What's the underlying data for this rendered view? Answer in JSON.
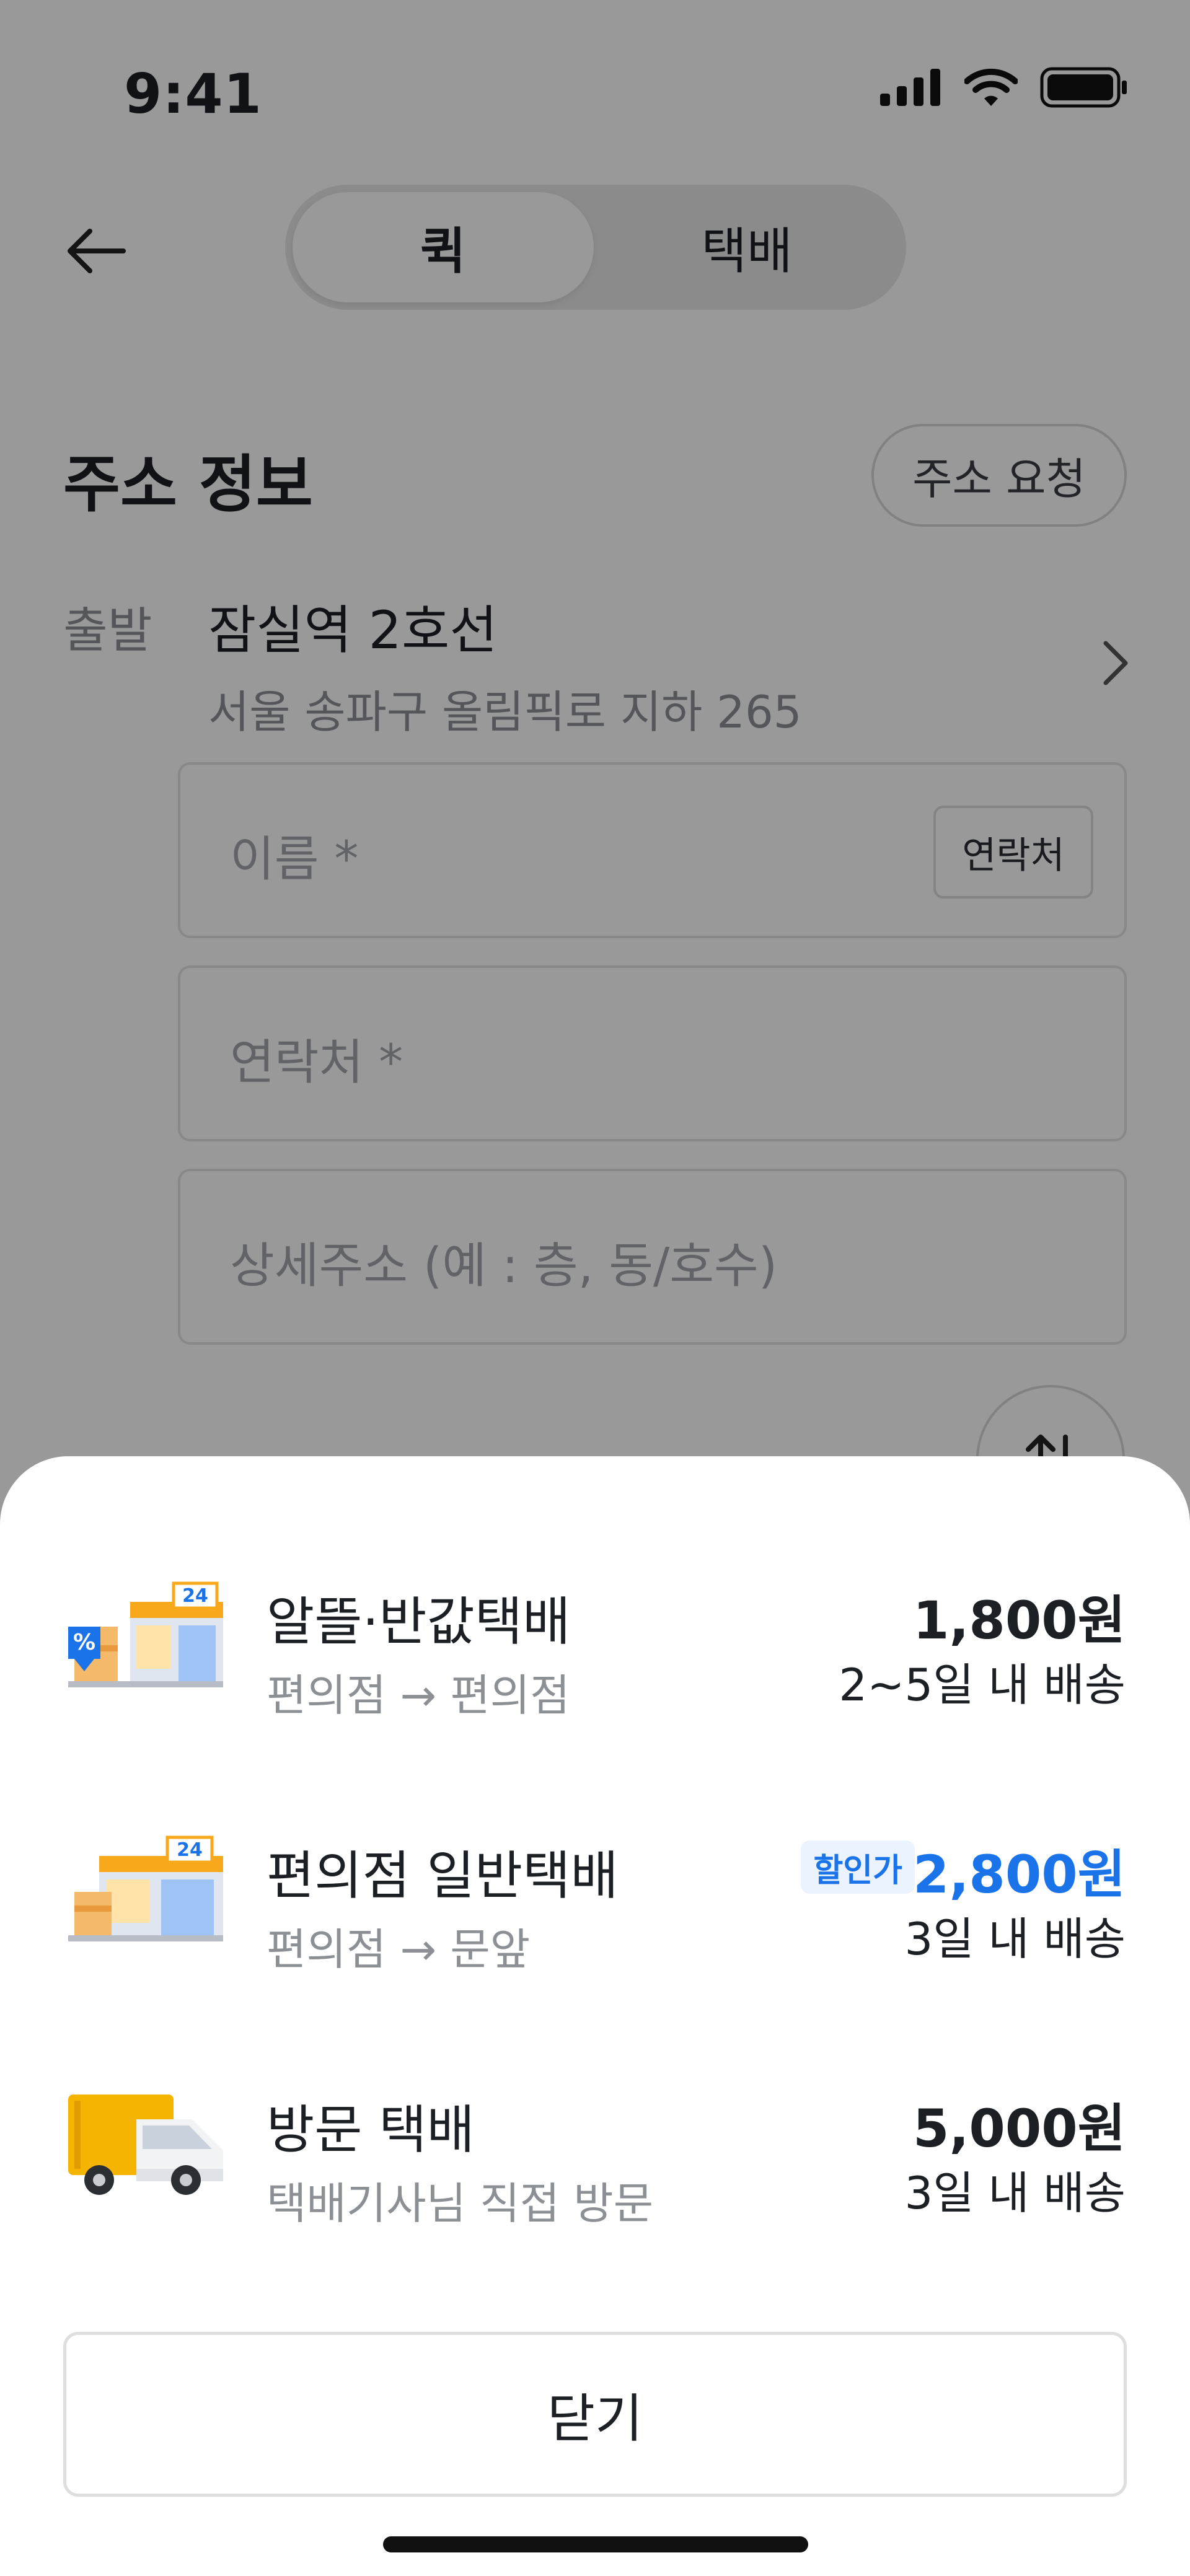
{
  "status_bar": {
    "time": "9:41"
  },
  "header": {
    "tabs": [
      {
        "label": "퀵",
        "active": true
      },
      {
        "label": "택배",
        "active": false
      }
    ]
  },
  "address_section": {
    "title": "주소 정보",
    "request_button": "주소 요청",
    "departure": {
      "label": "출발",
      "name": "잠실역 2호선",
      "address": "서울 송파구 올림픽로 지하 265"
    },
    "fields": {
      "name_placeholder": "이름 *",
      "contacts_button": "연락처",
      "phone_placeholder": "연락처 *",
      "detail_placeholder": "상세주소 (예 : 층, 동/호수)"
    }
  },
  "delivery_sheet": {
    "options": [
      {
        "title": "알뜰·반값택배",
        "route": "편의점 → 편의점",
        "price": "1,800원",
        "eta": "2~5일 내 배송",
        "icon": "convenience-store-discount-icon"
      },
      {
        "title": "편의점 일반택배",
        "route": "편의점 → 문앞",
        "badge": "할인가",
        "price": "2,800원",
        "eta": "3일 내 배송",
        "icon": "convenience-store-icon"
      },
      {
        "title": "방문 택배",
        "route": "택배기사님 직접 방문",
        "price": "5,000원",
        "eta": "3일 내 배송",
        "icon": "delivery-truck-icon"
      }
    ],
    "close_label": "닫기"
  },
  "colors": {
    "accent_blue": "#1a73e8",
    "badge_bg": "#eaf3ff",
    "store_orange": "#f7a81b",
    "truck_yellow": "#f5b400"
  }
}
